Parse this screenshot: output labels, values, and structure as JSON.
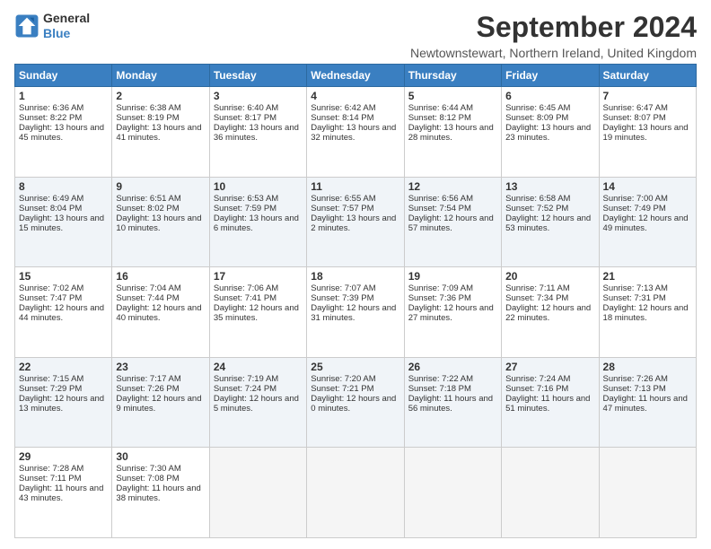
{
  "logo": {
    "line1": "General",
    "line2": "Blue"
  },
  "title": "September 2024",
  "subtitle": "Newtownstewart, Northern Ireland, United Kingdom",
  "days": [
    "Sunday",
    "Monday",
    "Tuesday",
    "Wednesday",
    "Thursday",
    "Friday",
    "Saturday"
  ],
  "weeks": [
    [
      {
        "num": "1",
        "rise": "6:36 AM",
        "set": "8:22 PM",
        "daylight": "13 hours and 45 minutes."
      },
      {
        "num": "2",
        "rise": "6:38 AM",
        "set": "8:19 PM",
        "daylight": "13 hours and 41 minutes."
      },
      {
        "num": "3",
        "rise": "6:40 AM",
        "set": "8:17 PM",
        "daylight": "13 hours and 36 minutes."
      },
      {
        "num": "4",
        "rise": "6:42 AM",
        "set": "8:14 PM",
        "daylight": "13 hours and 32 minutes."
      },
      {
        "num": "5",
        "rise": "6:44 AM",
        "set": "8:12 PM",
        "daylight": "13 hours and 28 minutes."
      },
      {
        "num": "6",
        "rise": "6:45 AM",
        "set": "8:09 PM",
        "daylight": "13 hours and 23 minutes."
      },
      {
        "num": "7",
        "rise": "6:47 AM",
        "set": "8:07 PM",
        "daylight": "13 hours and 19 minutes."
      }
    ],
    [
      {
        "num": "8",
        "rise": "6:49 AM",
        "set": "8:04 PM",
        "daylight": "13 hours and 15 minutes."
      },
      {
        "num": "9",
        "rise": "6:51 AM",
        "set": "8:02 PM",
        "daylight": "13 hours and 10 minutes."
      },
      {
        "num": "10",
        "rise": "6:53 AM",
        "set": "7:59 PM",
        "daylight": "13 hours and 6 minutes."
      },
      {
        "num": "11",
        "rise": "6:55 AM",
        "set": "7:57 PM",
        "daylight": "13 hours and 2 minutes."
      },
      {
        "num": "12",
        "rise": "6:56 AM",
        "set": "7:54 PM",
        "daylight": "12 hours and 57 minutes."
      },
      {
        "num": "13",
        "rise": "6:58 AM",
        "set": "7:52 PM",
        "daylight": "12 hours and 53 minutes."
      },
      {
        "num": "14",
        "rise": "7:00 AM",
        "set": "7:49 PM",
        "daylight": "12 hours and 49 minutes."
      }
    ],
    [
      {
        "num": "15",
        "rise": "7:02 AM",
        "set": "7:47 PM",
        "daylight": "12 hours and 44 minutes."
      },
      {
        "num": "16",
        "rise": "7:04 AM",
        "set": "7:44 PM",
        "daylight": "12 hours and 40 minutes."
      },
      {
        "num": "17",
        "rise": "7:06 AM",
        "set": "7:41 PM",
        "daylight": "12 hours and 35 minutes."
      },
      {
        "num": "18",
        "rise": "7:07 AM",
        "set": "7:39 PM",
        "daylight": "12 hours and 31 minutes."
      },
      {
        "num": "19",
        "rise": "7:09 AM",
        "set": "7:36 PM",
        "daylight": "12 hours and 27 minutes."
      },
      {
        "num": "20",
        "rise": "7:11 AM",
        "set": "7:34 PM",
        "daylight": "12 hours and 22 minutes."
      },
      {
        "num": "21",
        "rise": "7:13 AM",
        "set": "7:31 PM",
        "daylight": "12 hours and 18 minutes."
      }
    ],
    [
      {
        "num": "22",
        "rise": "7:15 AM",
        "set": "7:29 PM",
        "daylight": "12 hours and 13 minutes."
      },
      {
        "num": "23",
        "rise": "7:17 AM",
        "set": "7:26 PM",
        "daylight": "12 hours and 9 minutes."
      },
      {
        "num": "24",
        "rise": "7:19 AM",
        "set": "7:24 PM",
        "daylight": "12 hours and 5 minutes."
      },
      {
        "num": "25",
        "rise": "7:20 AM",
        "set": "7:21 PM",
        "daylight": "12 hours and 0 minutes."
      },
      {
        "num": "26",
        "rise": "7:22 AM",
        "set": "7:18 PM",
        "daylight": "11 hours and 56 minutes."
      },
      {
        "num": "27",
        "rise": "7:24 AM",
        "set": "7:16 PM",
        "daylight": "11 hours and 51 minutes."
      },
      {
        "num": "28",
        "rise": "7:26 AM",
        "set": "7:13 PM",
        "daylight": "11 hours and 47 minutes."
      }
    ],
    [
      {
        "num": "29",
        "rise": "7:28 AM",
        "set": "7:11 PM",
        "daylight": "11 hours and 43 minutes."
      },
      {
        "num": "30",
        "rise": "7:30 AM",
        "set": "7:08 PM",
        "daylight": "11 hours and 38 minutes."
      },
      null,
      null,
      null,
      null,
      null
    ]
  ]
}
